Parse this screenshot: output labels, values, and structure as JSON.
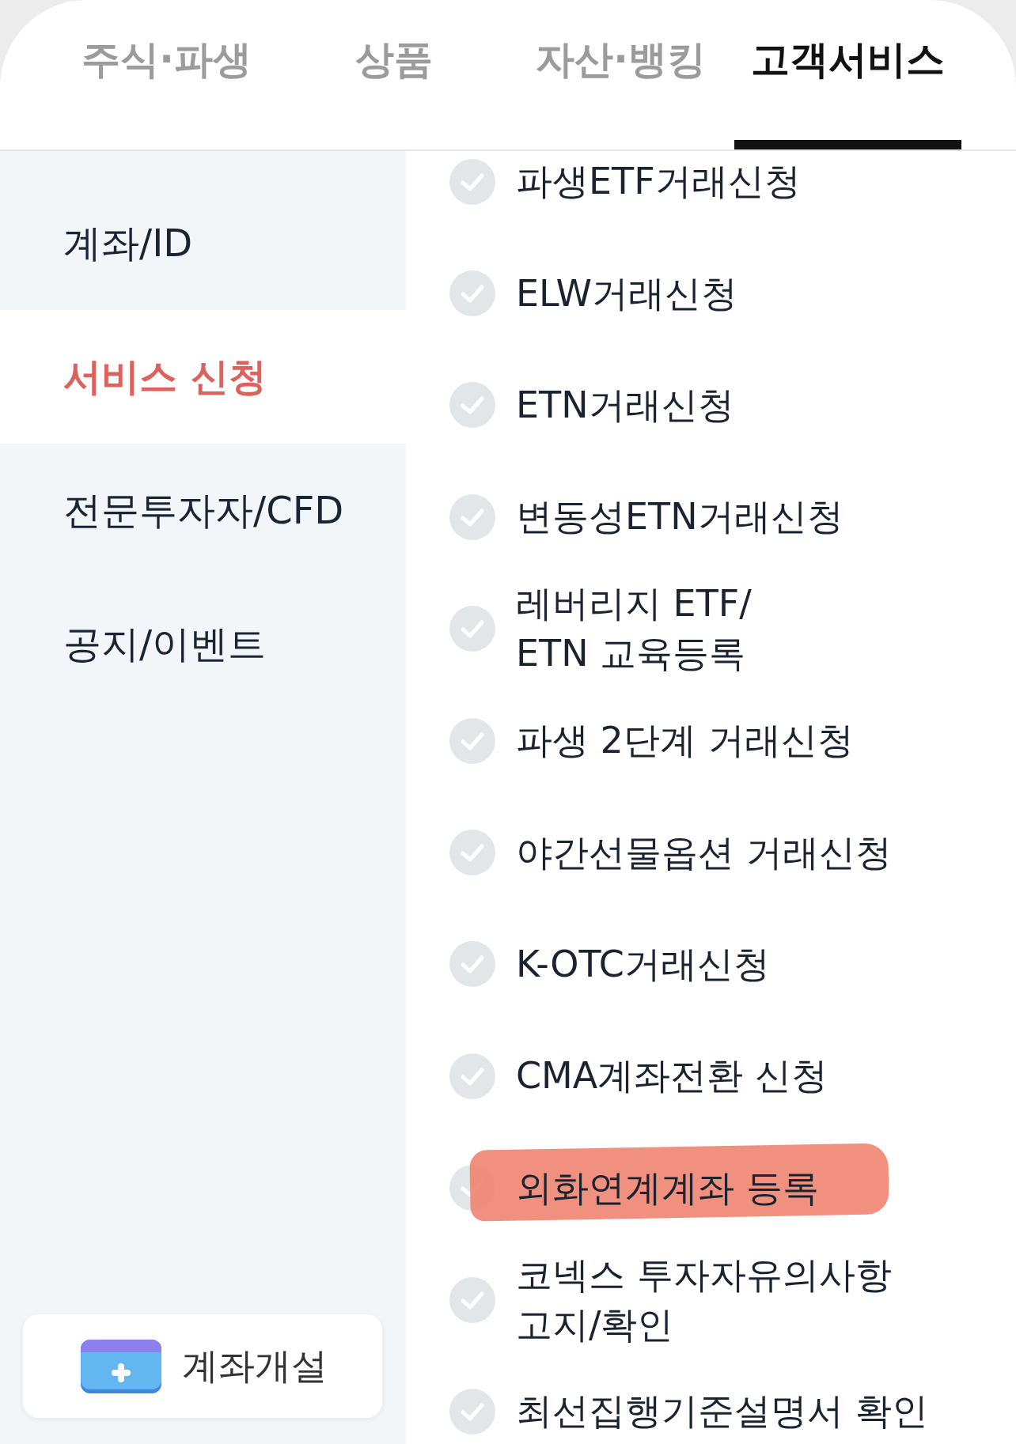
{
  "tabs": [
    {
      "label": "주식·파생",
      "selected": false
    },
    {
      "label": "상품",
      "selected": false
    },
    {
      "label": "자산·뱅킹",
      "selected": false
    },
    {
      "label": "고객서비스",
      "selected": true
    }
  ],
  "sidebar": {
    "items": [
      {
        "label": "계좌/ID",
        "selected": false
      },
      {
        "label": "서비스 신청",
        "selected": true
      },
      {
        "label": "전문투자자/CFD",
        "selected": false
      },
      {
        "label": "공지/이벤트",
        "selected": false
      }
    ],
    "open_account_button": {
      "label": "계좌개설"
    }
  },
  "services": [
    {
      "label": "파생ETF거래신청",
      "checked": false,
      "highlighted": false
    },
    {
      "label": "ELW거래신청",
      "checked": false,
      "highlighted": false
    },
    {
      "label": "ETN거래신청",
      "checked": false,
      "highlighted": false
    },
    {
      "label": "변동성ETN거래신청",
      "checked": false,
      "highlighted": false
    },
    {
      "label": "레버리지 ETF/\nETN 교육등록",
      "checked": false,
      "highlighted": false
    },
    {
      "label": "파생 2단계 거래신청",
      "checked": false,
      "highlighted": false
    },
    {
      "label": "야간선물옵션 거래신청",
      "checked": false,
      "highlighted": false
    },
    {
      "label": "K-OTC거래신청",
      "checked": false,
      "highlighted": false
    },
    {
      "label": "CMA계좌전환 신청",
      "checked": false,
      "highlighted": false
    },
    {
      "label": "외화연계계좌 등록",
      "checked": false,
      "highlighted": true
    },
    {
      "label": "코넥스 투자자유의사항\n고지/확인",
      "checked": false,
      "highlighted": false
    },
    {
      "label": "최선집행기준설명서 확인",
      "checked": false,
      "highlighted": false
    }
  ]
}
